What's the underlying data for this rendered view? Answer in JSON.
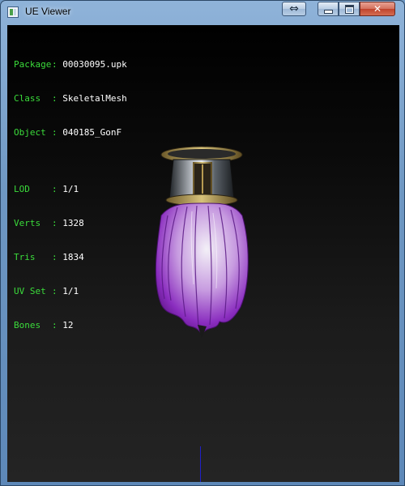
{
  "window": {
    "title": "UE Viewer",
    "close_glyph": "✕",
    "swap_glyph": "⇔"
  },
  "info": {
    "package": {
      "label": "Package",
      "value": "00030095.upk"
    },
    "class": {
      "label": "Class",
      "value": "SkeletalMesh"
    },
    "object": {
      "label": "Object",
      "value": "040185_GonF"
    },
    "lod": {
      "label": "LOD",
      "value": "1/1"
    },
    "verts": {
      "label": "Verts",
      "value": "1328"
    },
    "tris": {
      "label": "Tris",
      "value": "1834"
    },
    "uvset": {
      "label": "UV Set",
      "value": "1/1"
    },
    "bones": {
      "label": "Bones",
      "value": "12"
    },
    "separator": ":"
  },
  "colors": {
    "label_green": "#3bdc3b",
    "value_white": "#ffffff",
    "axis_blue": "#2020c8",
    "hair_purple": "#9a3bc6"
  }
}
